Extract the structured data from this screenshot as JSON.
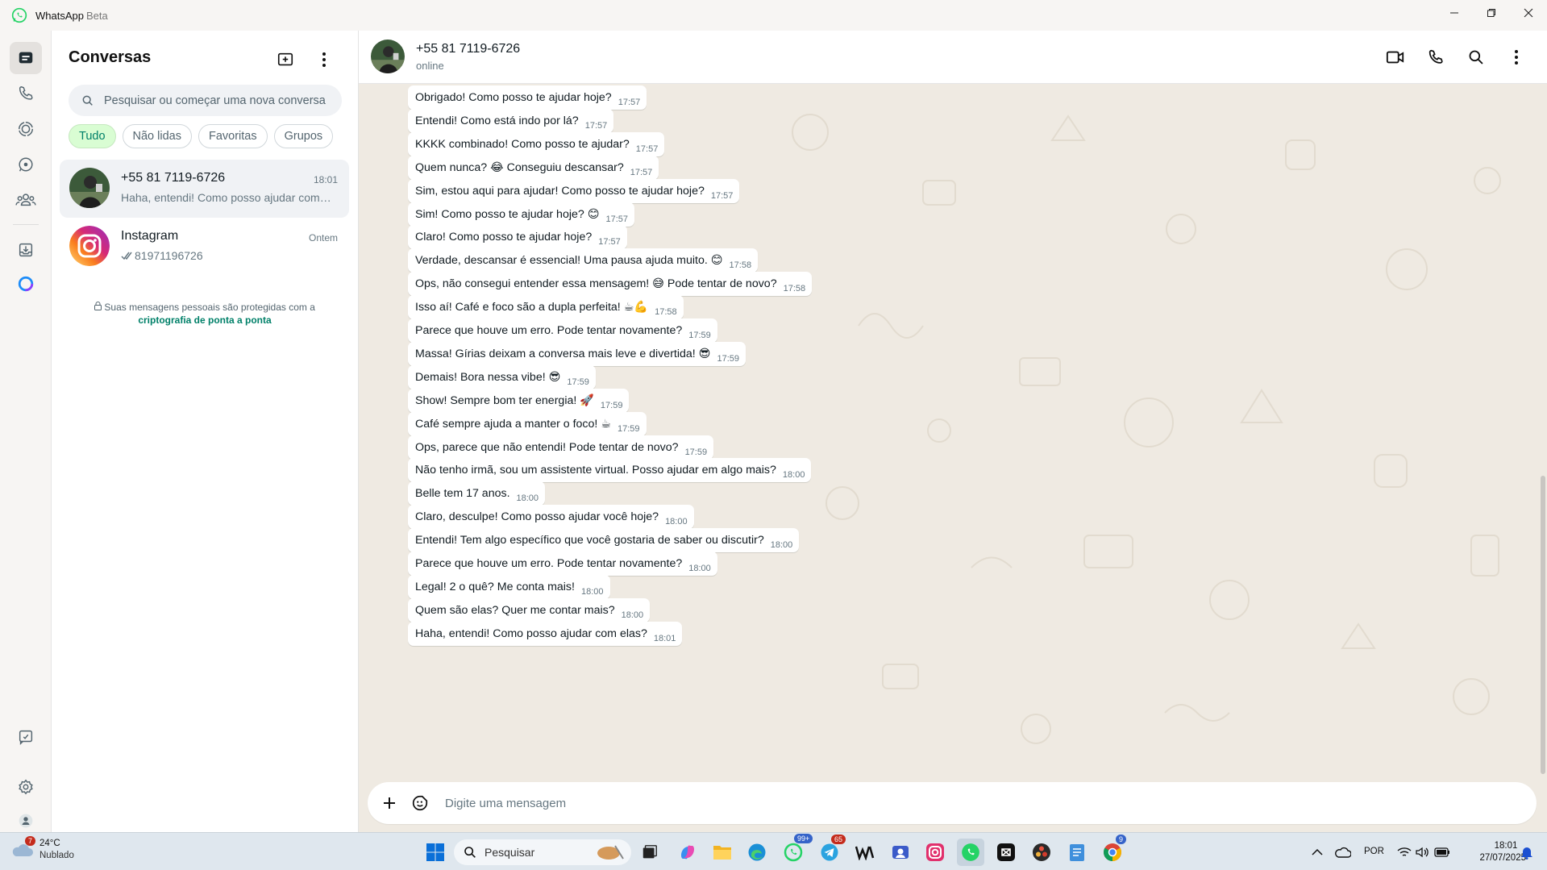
{
  "window": {
    "app_name": "WhatsApp",
    "app_tag": "Beta"
  },
  "rail": {
    "items": [
      "chats-icon",
      "calls-icon",
      "status-icon",
      "channels-icon",
      "communities-icon",
      "archived-icon",
      "meta-ai-icon",
      "starred-icon",
      "settings-icon",
      "profile-icon"
    ]
  },
  "chatlist": {
    "title": "Conversas",
    "search_placeholder": "Pesquisar ou começar uma nova conversa",
    "filters": [
      "Tudo",
      "Não lidas",
      "Favoritas",
      "Grupos"
    ],
    "active_filter": "Tudo",
    "chats": [
      {
        "name": "+55 81 7119-6726",
        "time": "18:01",
        "preview": "Haha, entendi! Como posso ajudar com elas?"
      },
      {
        "name": "Instagram",
        "time": "Ontem",
        "preview": "81971196726"
      }
    ],
    "encryption_note": "Suas mensagens pessoais são protegidas com a",
    "encryption_link": "criptografia de ponta a ponta"
  },
  "conversation": {
    "contact": "+55 81 7119-6726",
    "status": "online",
    "composer_placeholder": "Digite uma mensagem",
    "messages": [
      {
        "text": "Obrigado! Como posso te ajudar hoje?",
        "time": "17:57"
      },
      {
        "text": "Entendi! Como está indo por lá?",
        "time": "17:57"
      },
      {
        "text": "KKKK combinado! Como posso te ajudar?",
        "time": "17:57"
      },
      {
        "text": "Quem nunca? 😂 Conseguiu descansar?",
        "time": "17:57"
      },
      {
        "text": "Sim, estou aqui para ajudar! Como posso te ajudar hoje?",
        "time": "17:57"
      },
      {
        "text": "Sim! Como posso te ajudar hoje? 😊",
        "time": "17:57"
      },
      {
        "text": "Claro! Como posso te ajudar hoje?",
        "time": "17:57"
      },
      {
        "text": "Verdade, descansar é essencial! Uma pausa ajuda muito. 😊",
        "time": "17:58"
      },
      {
        "text": "Ops, não consegui entender essa mensagem! 😅 Pode tentar de novo?",
        "time": "17:58"
      },
      {
        "text": "Isso aí! Café e foco são a dupla perfeita! ☕💪",
        "time": "17:58"
      },
      {
        "text": "Parece que houve um erro. Pode tentar novamente?",
        "time": "17:59"
      },
      {
        "text": "Massa! Gírias deixam a conversa mais leve e divertida! 😎",
        "time": "17:59"
      },
      {
        "text": "Demais! Bora nessa vibe! 😎",
        "time": "17:59"
      },
      {
        "text": "Show! Sempre bom ter energia! 🚀",
        "time": "17:59"
      },
      {
        "text": "Café sempre ajuda a manter o foco! ☕",
        "time": "17:59"
      },
      {
        "text": "Ops, parece que não entendi! Pode tentar de novo?",
        "time": "17:59"
      },
      {
        "text": "Não tenho irmã, sou um assistente virtual. Posso ajudar em algo mais?",
        "time": "18:00"
      },
      {
        "text": "Belle tem 17 anos.",
        "time": "18:00"
      },
      {
        "text": "Claro, desculpe! Como posso ajudar você hoje?",
        "time": "18:00"
      },
      {
        "text": "Entendi! Tem algo específico que você gostaria de saber ou discutir?",
        "time": "18:00"
      },
      {
        "text": "Parece que houve um erro. Pode tentar novamente?",
        "time": "18:00"
      },
      {
        "text": "Legal! 2 o quê? Me conta mais!",
        "time": "18:00"
      },
      {
        "text": "Quem são elas? Quer me contar mais?",
        "time": "18:00"
      },
      {
        "text": "Haha, entendi! Como posso ajudar com elas?",
        "time": "18:01"
      }
    ]
  },
  "taskbar": {
    "weather_temp": "24°C",
    "weather_desc": "Nublado",
    "weather_badge": "7",
    "search_label": "Pesquisar",
    "whatsapp_badge": "99+",
    "telegram_badge": "65",
    "chrome_badge": "9",
    "lang": "POR",
    "time": "18:01",
    "date": "27/07/2025"
  },
  "colors": {
    "accent": "#008069",
    "chip_active_bg": "#d9fdd3",
    "chat_bg": "#efeae2",
    "bubble": "#ffffff"
  }
}
